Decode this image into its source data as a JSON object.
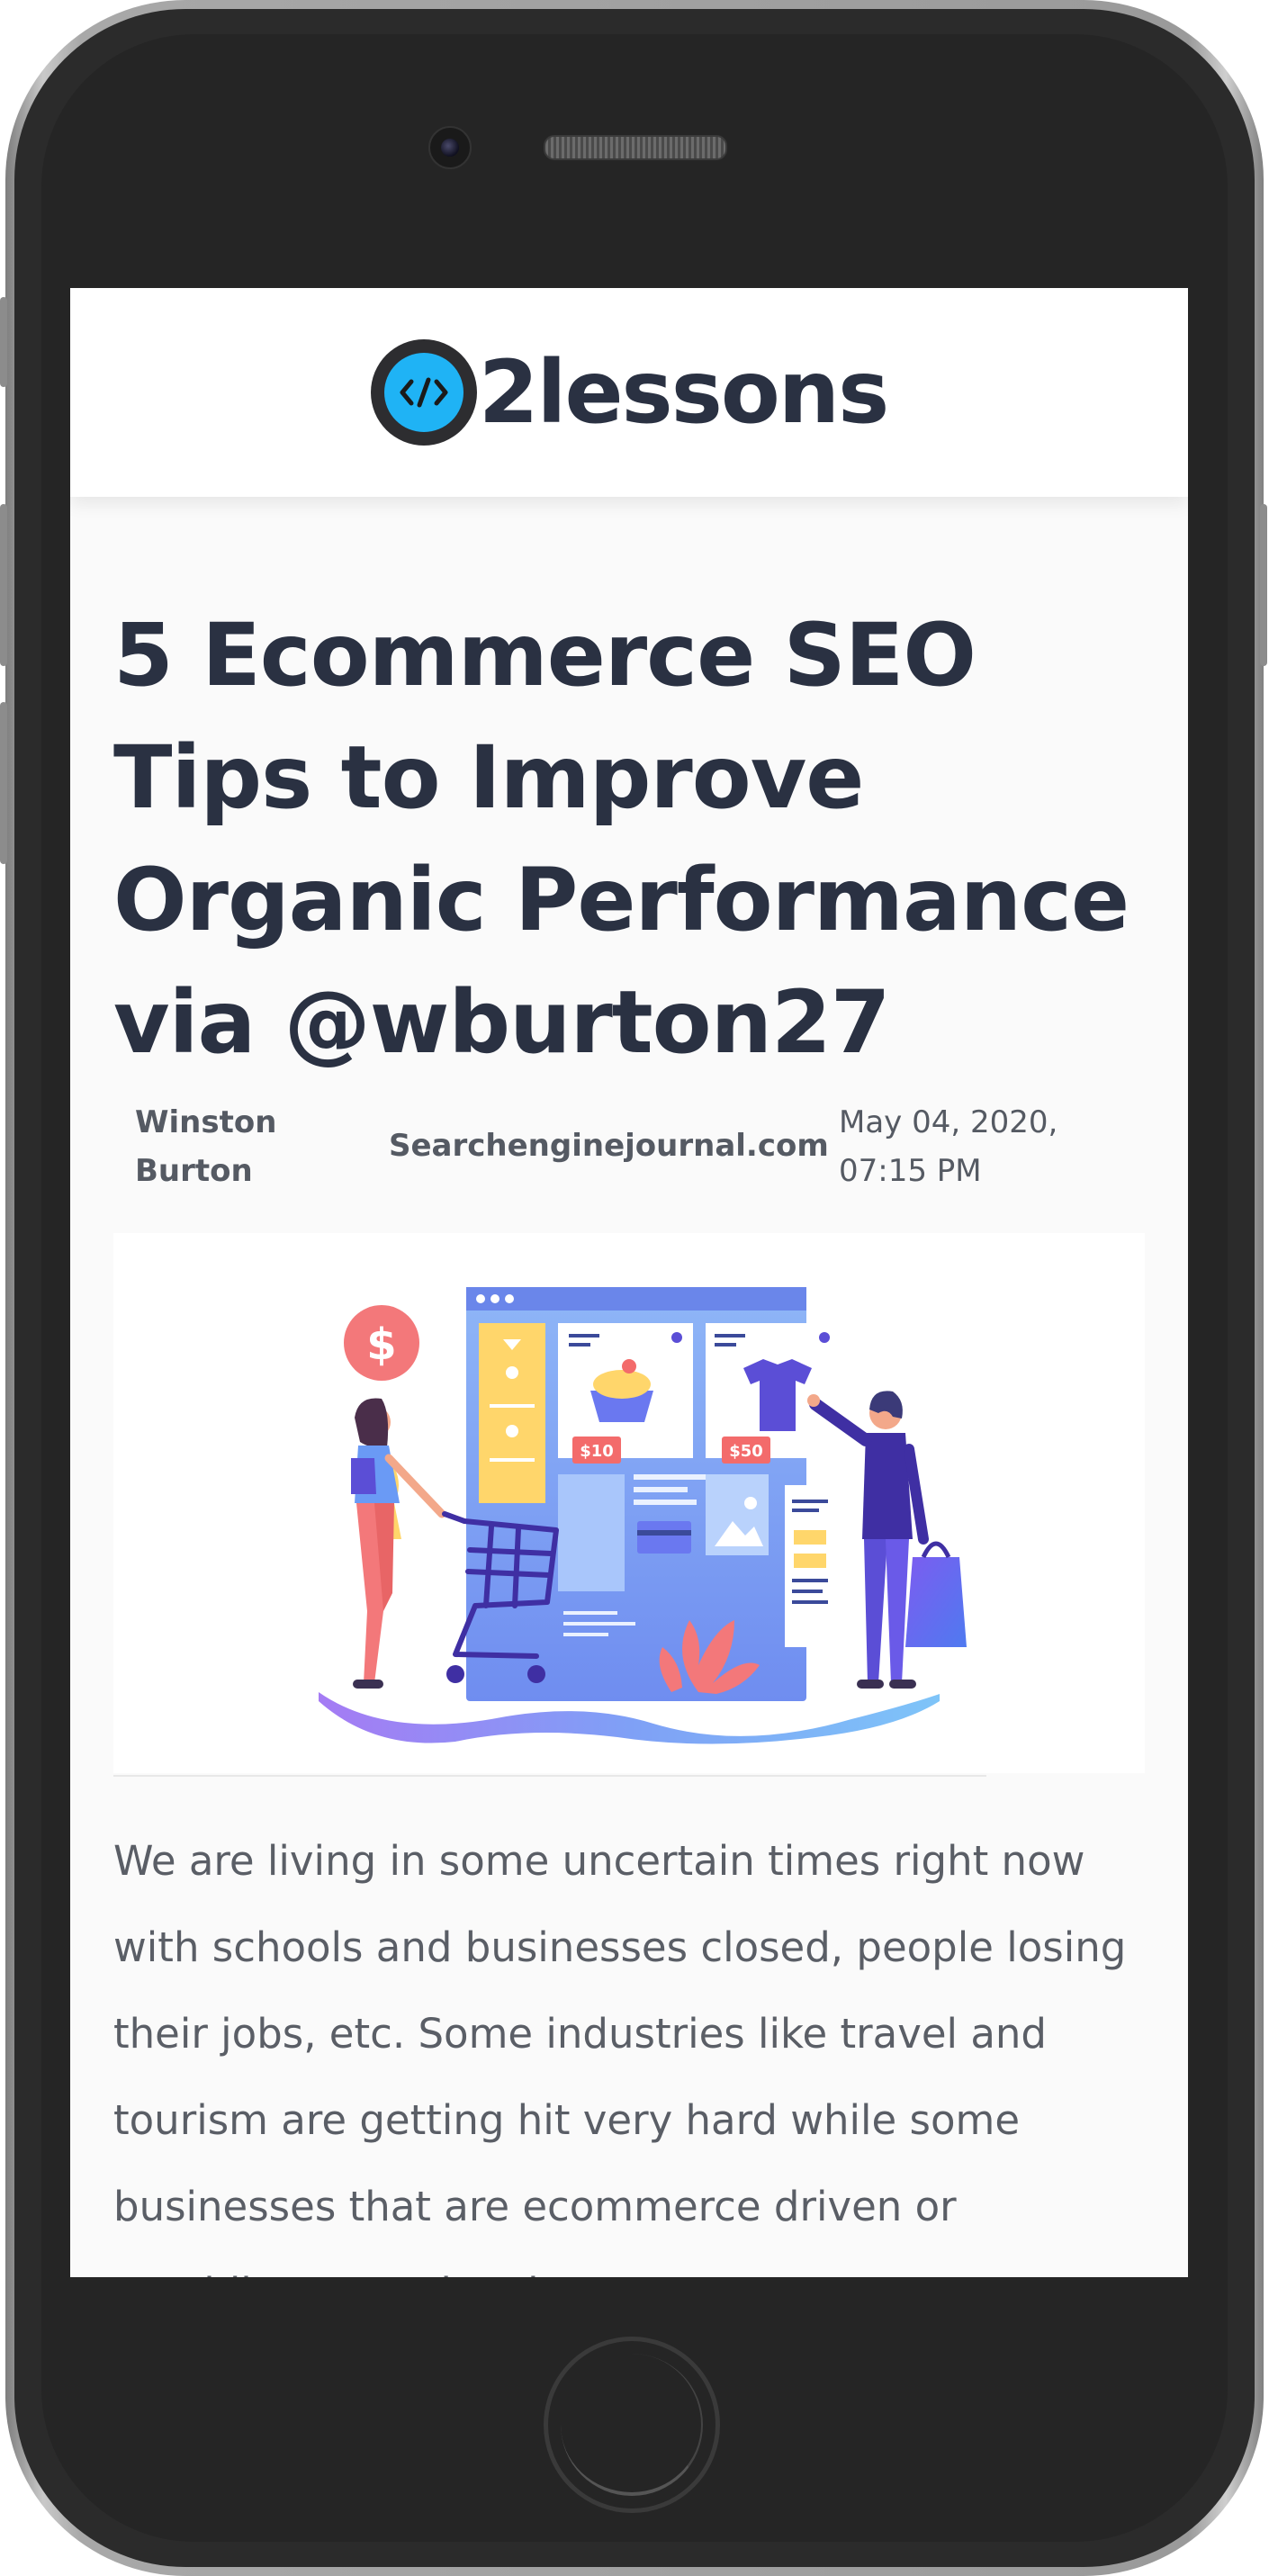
{
  "header": {
    "logo_text": "2lessons",
    "logo_icon": "code-icon",
    "logo_colors": {
      "ring": "#2d2d30",
      "fill": "#1fb3f5"
    }
  },
  "article": {
    "title": "5 Ecommerce SEO Tips to Improve Organic Performance via @wburton27",
    "author": "Winston Burton",
    "source": "Searchenginejournal.com",
    "date": "May 04, 2020, 07:15 PM",
    "image_labels": {
      "price_left": "$10",
      "price_right": "$50",
      "coin": "$"
    },
    "excerpt": "We are living in some uncertain times right now with schools and businesses closed, people losing their jobs, etc. Some industries like travel and tourism are getting hit very hard while some businesses that are ecommerce driven or providing a service that p..."
  },
  "colors": {
    "title_text": "#2a3142",
    "body_text": "#5a5e66",
    "accent_blue": "#1fb3f5"
  }
}
